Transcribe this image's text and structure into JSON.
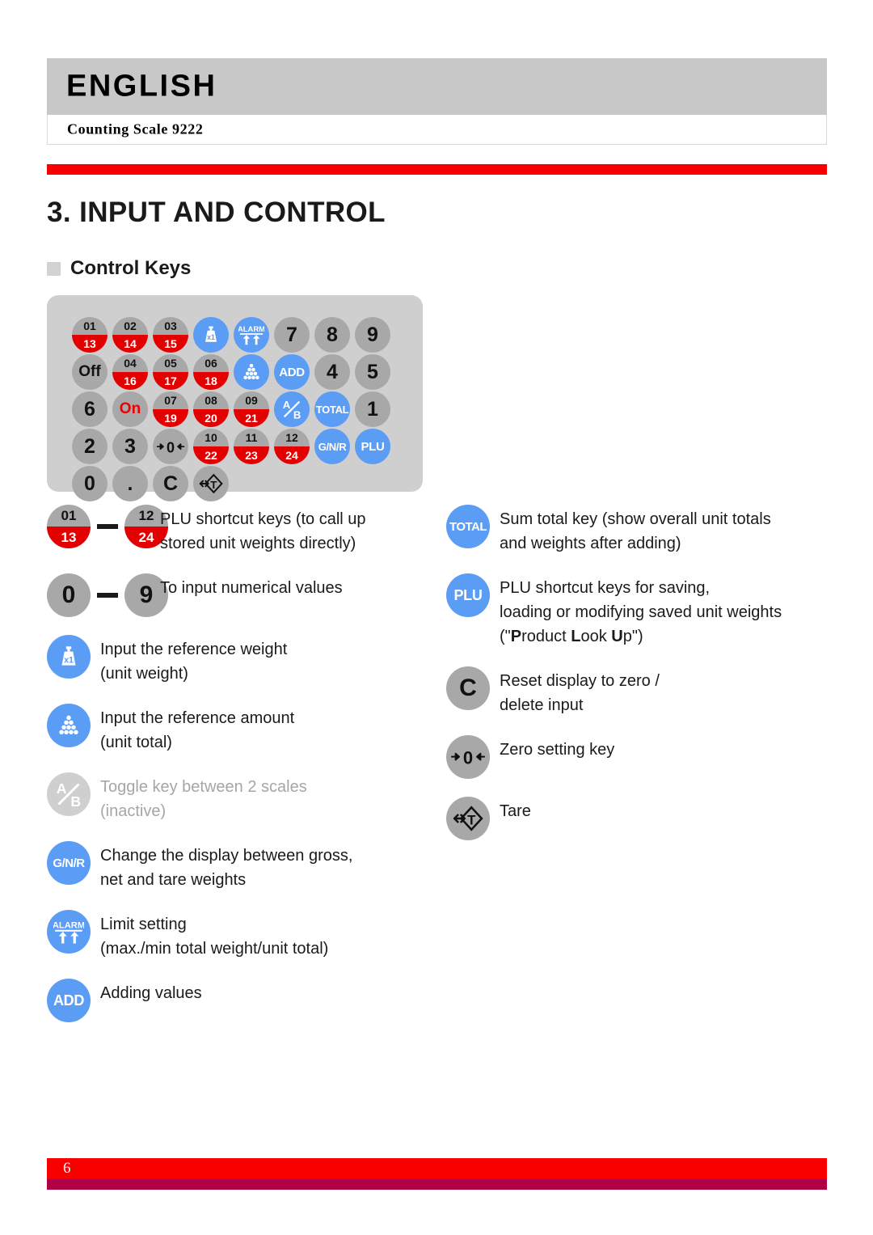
{
  "header": {
    "language": "ENGLISH",
    "model": "Counting Scale 9222"
  },
  "titles": {
    "chapter": "3. INPUT AND CONTROL",
    "section": "Control Keys"
  },
  "keypad": {
    "rows": [
      [
        {
          "type": "plu",
          "top": "01",
          "bottom": "13"
        },
        {
          "type": "plu",
          "top": "02",
          "bottom": "14"
        },
        {
          "type": "plu",
          "top": "03",
          "bottom": "15"
        },
        {
          "type": "icon",
          "icon": "unit-weight-icon"
        },
        {
          "type": "icon",
          "icon": "alarm-icon"
        },
        {
          "type": "num",
          "label": "7"
        },
        {
          "type": "num",
          "label": "8"
        },
        {
          "type": "num",
          "label": "9"
        },
        {
          "type": "power",
          "label": "Off"
        }
      ],
      [
        {
          "type": "plu",
          "top": "04",
          "bottom": "16"
        },
        {
          "type": "plu",
          "top": "05",
          "bottom": "17"
        },
        {
          "type": "plu",
          "top": "06",
          "bottom": "18"
        },
        {
          "type": "icon",
          "icon": "unit-total-icon"
        },
        {
          "type": "blue",
          "label": "ADD"
        },
        {
          "type": "num",
          "label": "4"
        },
        {
          "type": "num",
          "label": "5"
        },
        {
          "type": "num",
          "label": "6"
        },
        {
          "type": "power-on",
          "label": "On"
        }
      ],
      [
        {
          "type": "plu",
          "top": "07",
          "bottom": "19"
        },
        {
          "type": "plu",
          "top": "08",
          "bottom": "20"
        },
        {
          "type": "plu",
          "top": "09",
          "bottom": "21"
        },
        {
          "type": "icon",
          "icon": "ab-toggle-icon"
        },
        {
          "type": "blue",
          "label": "TOTAL"
        },
        {
          "type": "num",
          "label": "1"
        },
        {
          "type": "num",
          "label": "2"
        },
        {
          "type": "num",
          "label": "3"
        },
        {
          "type": "icon",
          "icon": "zero-set-icon"
        }
      ],
      [
        {
          "type": "plu",
          "top": "10",
          "bottom": "22"
        },
        {
          "type": "plu",
          "top": "11",
          "bottom": "23"
        },
        {
          "type": "plu",
          "top": "12",
          "bottom": "24"
        },
        {
          "type": "blue",
          "label": "G/N/R"
        },
        {
          "type": "blue",
          "label": "PLU"
        },
        {
          "type": "num",
          "label": "0"
        },
        {
          "type": "num",
          "label": "."
        },
        {
          "type": "num",
          "label": "C"
        },
        {
          "type": "icon",
          "icon": "tare-icon"
        }
      ]
    ]
  },
  "legend_left": [
    {
      "key_kind": "plu-range",
      "from_top": "01",
      "from_bottom": "13",
      "to_top": "12",
      "to_bottom": "24",
      "line1": "PLU shortcut keys (to call up",
      "line2": "stored unit weights directly)"
    },
    {
      "key_kind": "num-range",
      "from": "0",
      "to": "9",
      "line1": "To input numerical values",
      "line2": ""
    },
    {
      "key_kind": "icon-weight",
      "line1": "Input the reference weight",
      "line2": "(unit weight)"
    },
    {
      "key_kind": "icon-balls",
      "line1": "Input the reference amount",
      "line2": "(unit total)"
    },
    {
      "key_kind": "icon-ab",
      "muted": true,
      "line1": "Toggle key between 2 scales",
      "line2": "(inactive)"
    },
    {
      "key_kind": "label-blue",
      "label": "G/N/R",
      "line1": "Change the display between gross,",
      "line2": "net and tare weights"
    },
    {
      "key_kind": "icon-alarm",
      "line1": "Limit setting",
      "line2": "(max./min total weight/unit total)"
    },
    {
      "key_kind": "label-blue",
      "label": "ADD",
      "line1": "Adding values",
      "line2": ""
    }
  ],
  "legend_right": [
    {
      "key_kind": "label-blue",
      "label": "TOTAL",
      "line1": "Sum total key (show overall unit totals",
      "line2": "and weights after adding)"
    },
    {
      "key_kind": "label-blue-plu",
      "label": "PLU",
      "line1": "PLU shortcut keys for saving,",
      "line2": "loading or modifying saved unit weights",
      "line3_parts": [
        "(\"",
        "P",
        "roduct ",
        "L",
        "ook ",
        "U",
        "p\")"
      ]
    },
    {
      "key_kind": "label-gray",
      "label": "C",
      "line1": "Reset display to zero /",
      "line2": "delete input"
    },
    {
      "key_kind": "icon-zero",
      "line1": "Zero setting key",
      "line2": ""
    },
    {
      "key_kind": "icon-tare",
      "line1": "Tare",
      "line2": ""
    }
  ],
  "footer": {
    "page": "6"
  },
  "colors": {
    "red": "#f90000",
    "crimson": "#b00046",
    "blue": "#5b9cf5",
    "gray_key": "#a8a8a8",
    "panel": "#cfcfcf",
    "plu_red": "#e20000"
  }
}
